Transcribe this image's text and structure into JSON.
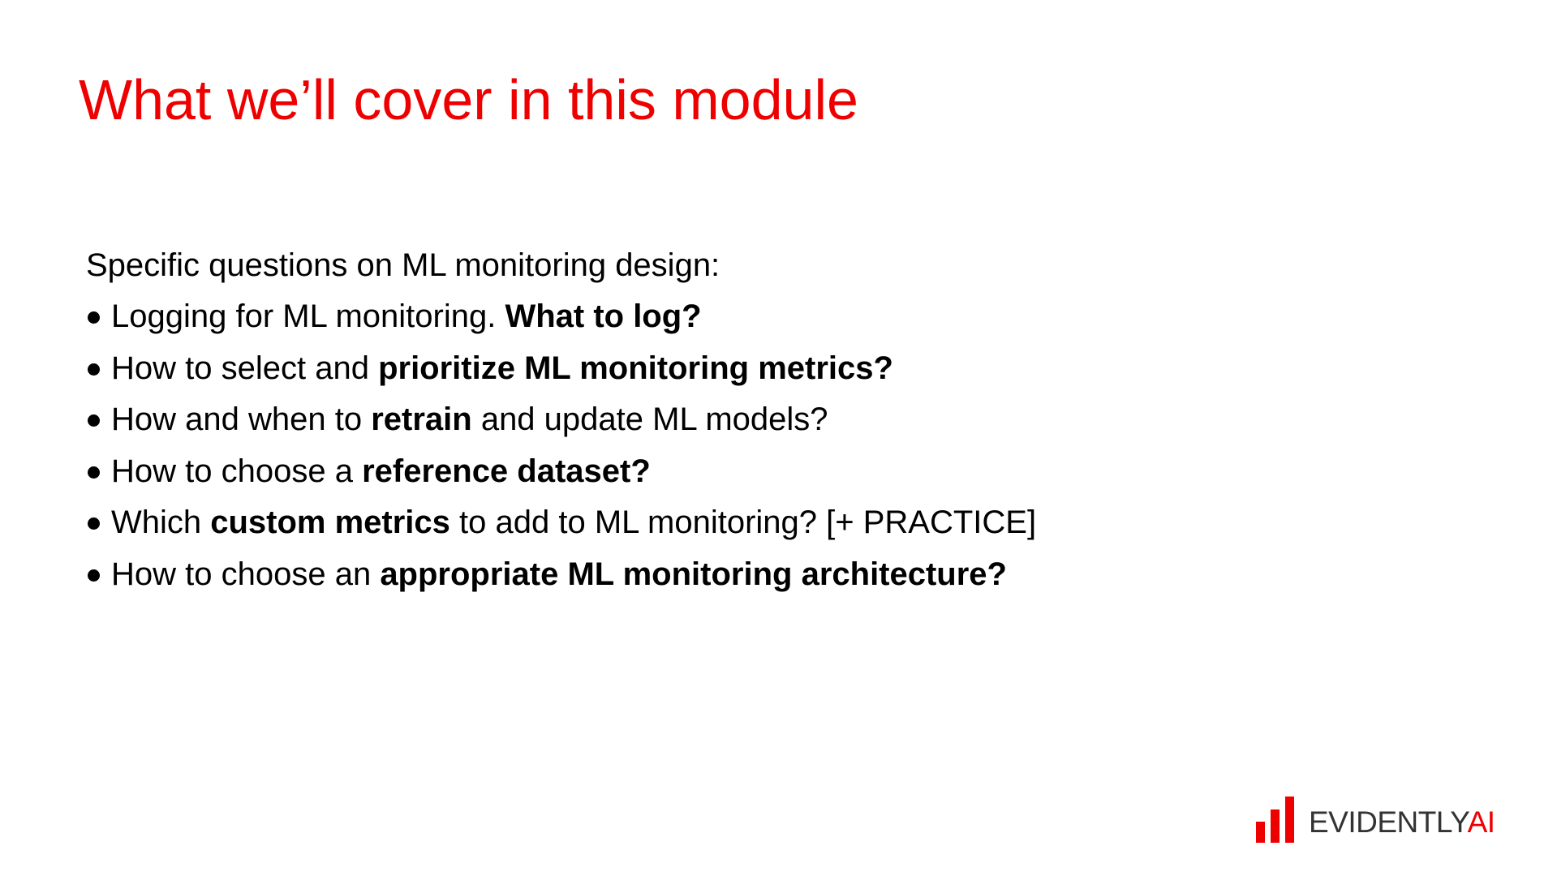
{
  "title": "What we’ll cover in this module",
  "intro": "Specific questions on ML monitoring design:",
  "bullets": [
    {
      "before": "Logging for ML monitoring. ",
      "bold": "What to log?",
      "after": ""
    },
    {
      "before": "How to select and ",
      "bold": "prioritize ML monitoring metrics?",
      "after": ""
    },
    {
      "before": "How and when to ",
      "bold": "retrain",
      "after": " and update ML models?"
    },
    {
      "before": "How to choose a ",
      "bold": "reference dataset?",
      "after": ""
    },
    {
      "before": "Which ",
      "bold": "custom metrics",
      "after": " to add to ML monitoring? [+ PRACTICE]"
    },
    {
      "before": "How to choose an ",
      "bold": "appropriate ML monitoring architecture?",
      "after": ""
    }
  ],
  "logo": {
    "word": "EVIDENTLY",
    "ai": "AI",
    "icon": "bar-chart-icon"
  },
  "colors": {
    "accent": "#ee0000",
    "text": "#000000",
    "logo_text": "#333333",
    "background": "#ffffff"
  }
}
